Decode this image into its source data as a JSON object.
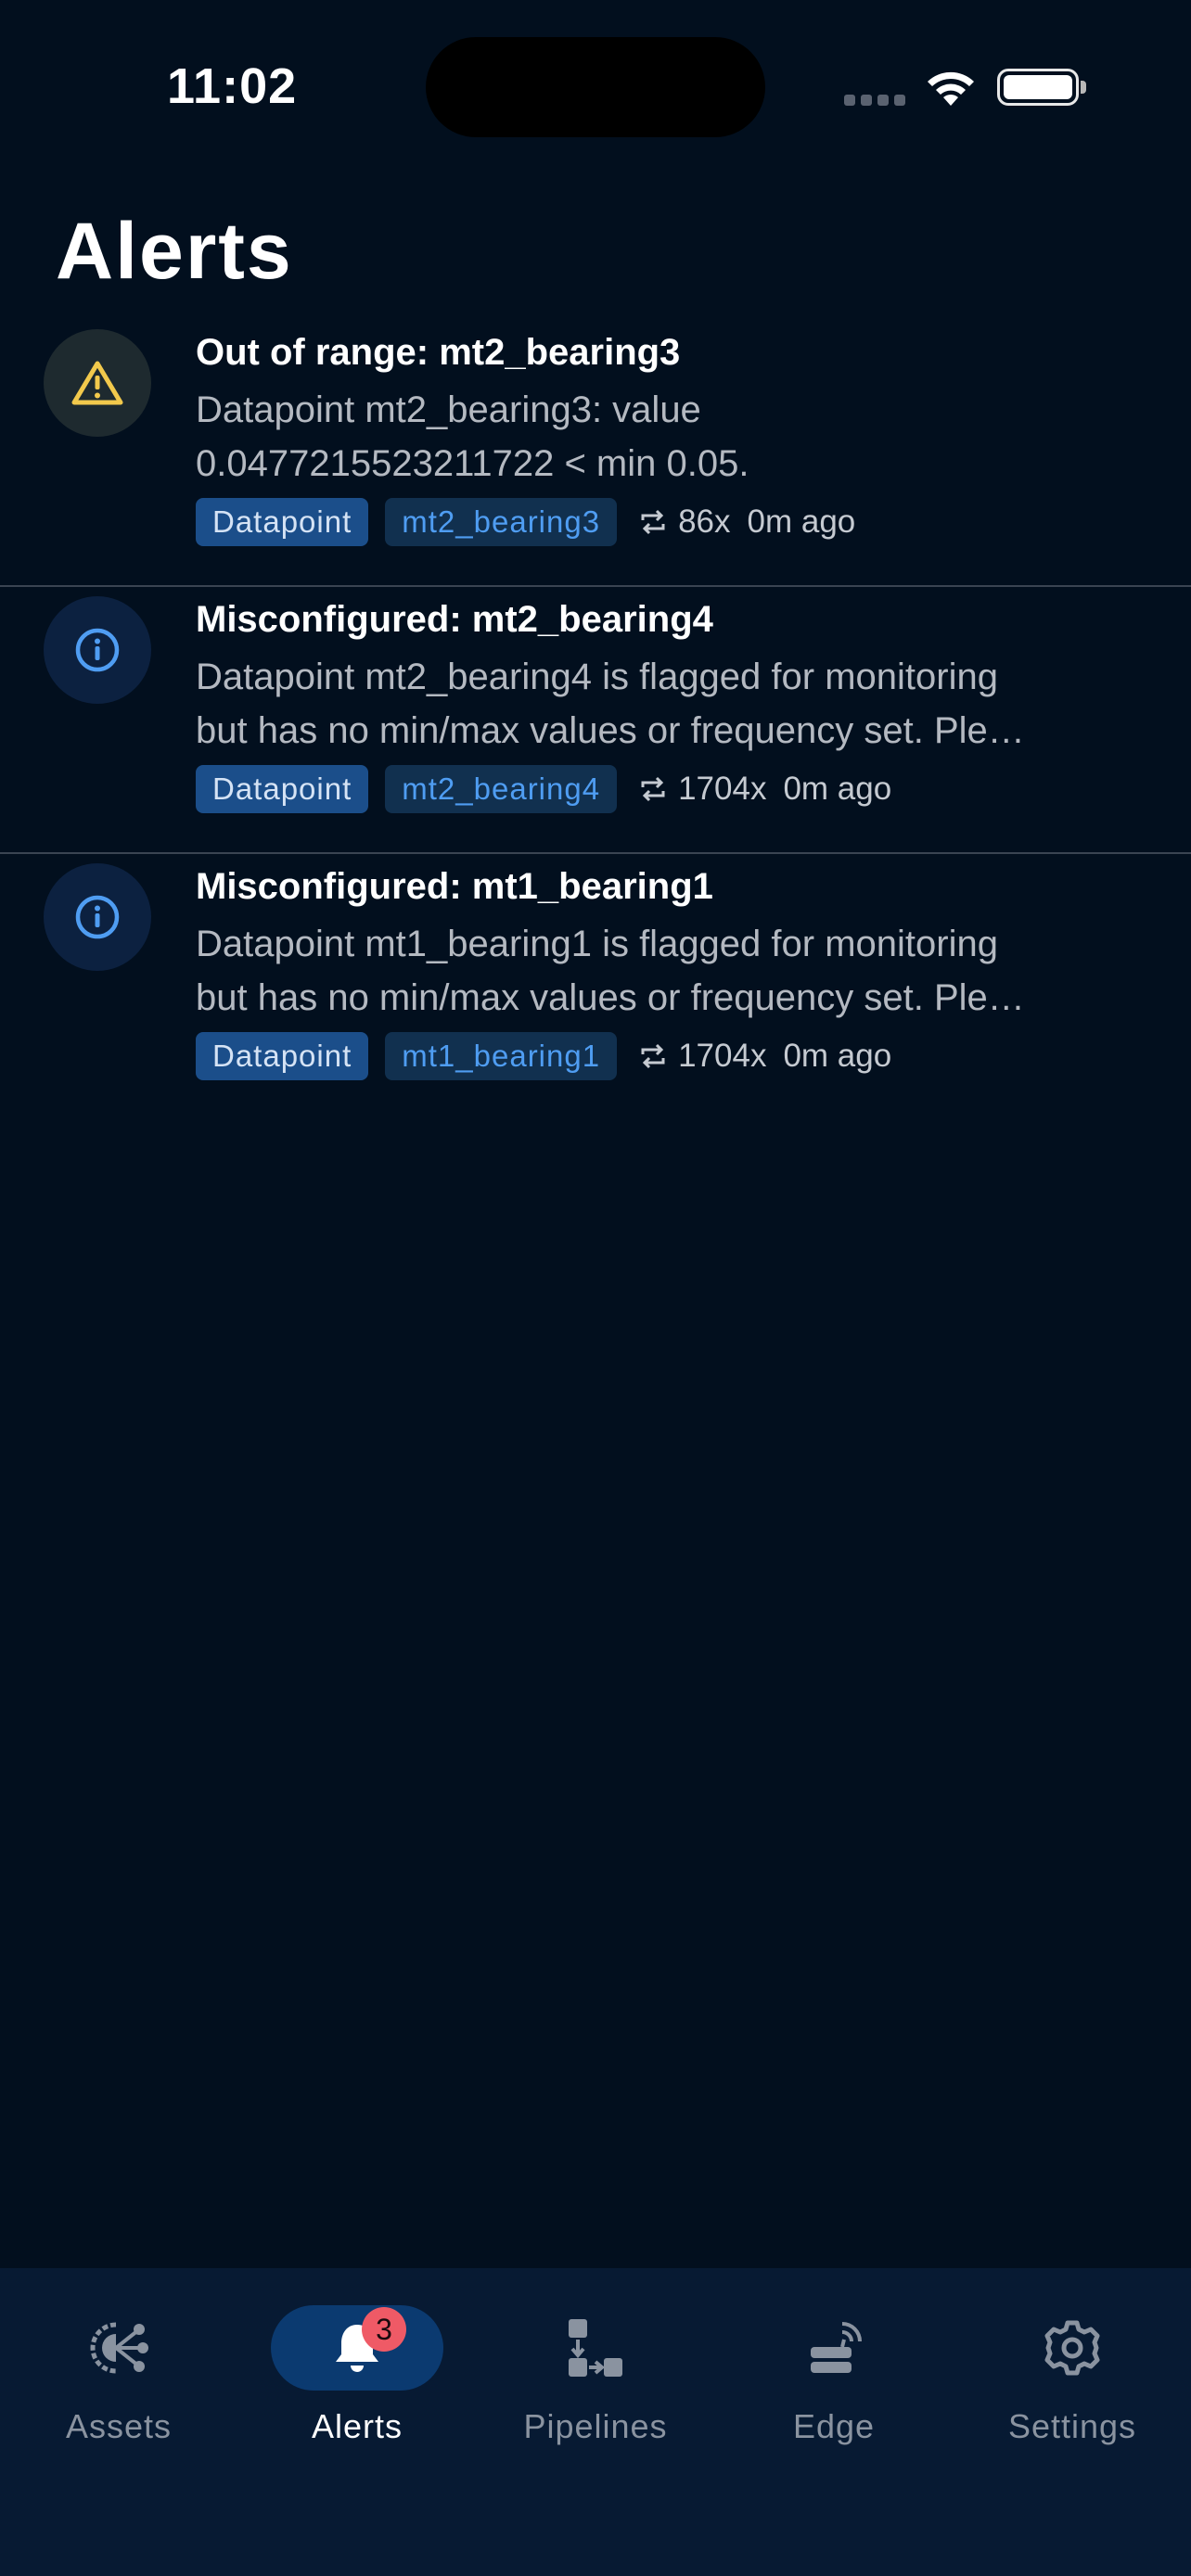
{
  "status_bar": {
    "time": "11:02"
  },
  "page": {
    "title": "Alerts"
  },
  "alerts": [
    {
      "severity": "warning",
      "icon": "warning-triangle-icon",
      "title": "Out of range: mt2_bearing3",
      "description_lines": [
        "Datapoint mt2_bearing3: value",
        "0.0477215523211722 < min 0.05."
      ],
      "type_chip": "Datapoint",
      "name_chip": "mt2_bearing3",
      "repeat_count": "86x",
      "age": "0m ago"
    },
    {
      "severity": "info",
      "icon": "info-circle-icon",
      "title": "Misconfigured: mt2_bearing4",
      "description_lines": [
        "Datapoint mt2_bearing4 is flagged for monitoring",
        "but has no min/max values or frequency set. Ple…"
      ],
      "type_chip": "Datapoint",
      "name_chip": "mt2_bearing4",
      "repeat_count": "1704x",
      "age": "0m ago"
    },
    {
      "severity": "info",
      "icon": "info-circle-icon",
      "title": "Misconfigured: mt1_bearing1",
      "description_lines": [
        "Datapoint mt1_bearing1 is flagged for monitoring",
        "but has no min/max values or frequency set. Ple…"
      ],
      "type_chip": "Datapoint",
      "name_chip": "mt1_bearing1",
      "repeat_count": "1704x",
      "age": "0m ago"
    }
  ],
  "tab_bar": {
    "tabs": [
      {
        "label": "Assets",
        "icon": "assets-icon",
        "active": false
      },
      {
        "label": "Alerts",
        "icon": "bell-icon",
        "active": true,
        "badge": "3"
      },
      {
        "label": "Pipelines",
        "icon": "pipelines-icon",
        "active": false
      },
      {
        "label": "Edge",
        "icon": "edge-device-icon",
        "active": false
      },
      {
        "label": "Settings",
        "icon": "gear-icon",
        "active": false
      }
    ]
  },
  "colors": {
    "background": "#020f1e",
    "tab_bar_background": "#071a33",
    "warning": "#f2c94c",
    "info": "#4f9df2",
    "badge": "#ef5a66"
  }
}
